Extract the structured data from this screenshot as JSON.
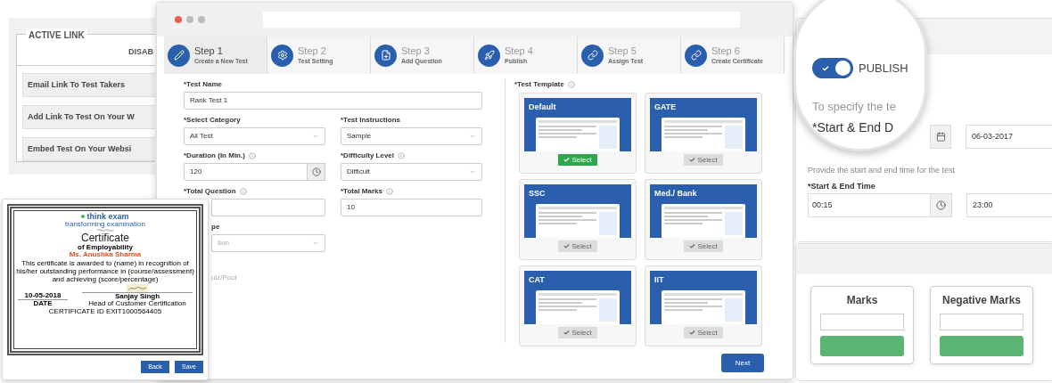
{
  "active_link_panel": {
    "heading": "ACTIVE LINK",
    "column_2": "DISAB",
    "links": [
      "Email Link To Test Takers",
      "Add Link To Test On Your W",
      "Embed Test On Your Websi"
    ]
  },
  "main_window": {
    "steps": [
      {
        "title": "Step 1",
        "subtitle": "Create a New Test",
        "kind": "pencil",
        "selected": true
      },
      {
        "title": "Step 2",
        "subtitle": "Test Setting",
        "kind": "gear",
        "selected": false
      },
      {
        "title": "Step 3",
        "subtitle": "Add Question",
        "kind": "file",
        "selected": false
      },
      {
        "title": "Step 4",
        "subtitle": "Publish",
        "kind": "rocket",
        "selected": false
      },
      {
        "title": "Step 5",
        "subtitle": "Assign Test",
        "kind": "link",
        "selected": false
      },
      {
        "title": "Step 6",
        "subtitle": "Create Certificate",
        "kind": "link",
        "selected": false
      }
    ],
    "fields": [
      {
        "label": "*Test Name",
        "value": "Rank Test 1",
        "kind": "text",
        "info": false
      },
      {
        "label": "*Select Category",
        "value": "All Test",
        "kind": "select",
        "info": false
      },
      {
        "label": "*Test Instructions",
        "value": "Sample",
        "kind": "select",
        "info": false
      },
      {
        "label": "*Duration (In Min.)",
        "value": "120",
        "kind": "clock",
        "info": true
      },
      {
        "label": "*Difficulty Level",
        "value": "Difficult",
        "kind": "select",
        "info": true
      },
      {
        "label": "*Total Question",
        "kind": "text",
        "info": true
      },
      {
        "label": "*Total Marks",
        "value": "10",
        "kind": "text",
        "info": true
      },
      {
        "label": "pe",
        "placeholder": "tion",
        "kind": "select",
        "info": false
      },
      {
        "label": "uiz/Pool",
        "kind": "note"
      }
    ],
    "template_label": "*Test Template",
    "templates": [
      {
        "name": "Default",
        "button": "Select",
        "selected": true
      },
      {
        "name": "GATE",
        "button": "Select",
        "selected": false
      },
      {
        "name": "SSC",
        "button": "Select",
        "selected": false
      },
      {
        "name": "Med./ Bank",
        "button": "Select",
        "selected": false
      },
      {
        "name": "CAT",
        "button": "Select",
        "selected": false
      },
      {
        "name": "IIT",
        "button": "Select",
        "selected": false
      }
    ],
    "next_button": "Next"
  },
  "certificate": {
    "logo": "think exam",
    "tagline": "transforming examination",
    "title": "Certificate",
    "subtitle": "of Employability",
    "recipient": "Ms. Anushka Sharma",
    "body": "This certificate is awarded to (name) in recognition of his/her outstanding performance in (course/assessment) and achieving (score/percentage)",
    "date": "10-05-2018",
    "date_label": "DATE",
    "signer": "Sanjay Singh",
    "signer_title": "Head of Customer Certification",
    "certificate_id": "CERTIFICATE ID EXIT1000564405",
    "buttons": [
      "Back",
      "Save"
    ]
  },
  "publish_panel": {
    "publish": {
      "label": "PUBLISH",
      "on": true
    },
    "intro": "To specify the te",
    "date_label": "*Start & End D",
    "end_date": "06-03-2017",
    "time_hint": "Provide the start and end time for the test",
    "time_label": "*Start & End Time",
    "start_time": "00:15",
    "end_time": "23:00"
  },
  "marks_panel": {
    "cards": [
      "Marks",
      "Negative Marks"
    ]
  }
}
